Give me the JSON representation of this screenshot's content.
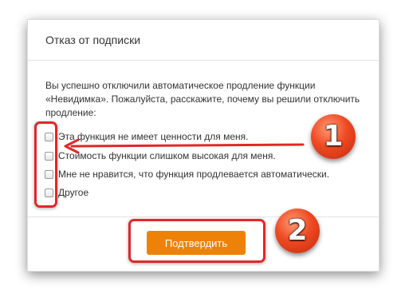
{
  "dialog": {
    "title": "Отказ от подписки",
    "description": "Вы успешно отключили автоматическое продление функции «Невидимка». Пожалуйста, расскажите, почему вы решили отключить продление:",
    "options": [
      {
        "label": "Эта функция не имеет ценности для меня.",
        "checked": false
      },
      {
        "label": "Стоимость функции слишком высокая для меня.",
        "checked": false
      },
      {
        "label": "Мне не нравится, что функция продлевается автоматически.",
        "checked": false
      },
      {
        "label": "Другое",
        "checked": false
      }
    ],
    "submit_label": "Подтвердить"
  },
  "annotations": {
    "badge_1": "1",
    "badge_2": "2",
    "color": "#e02828"
  }
}
